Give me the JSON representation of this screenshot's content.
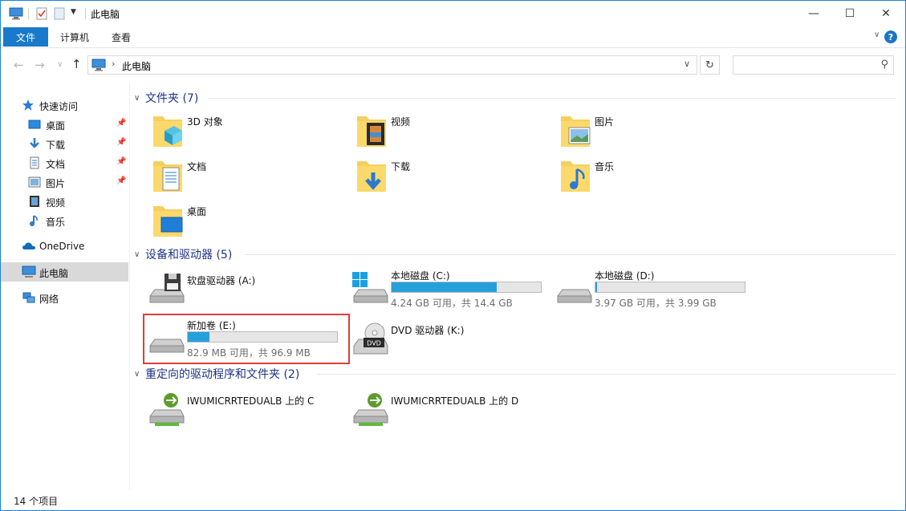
{
  "window": {
    "title": "此电脑",
    "controls": {
      "minimize": "—",
      "maximize": "☐",
      "close": "✕"
    }
  },
  "ribbon": {
    "tabs": [
      {
        "label": "文件",
        "active": true
      },
      {
        "label": "计算机",
        "active": false
      },
      {
        "label": "查看",
        "active": false
      }
    ],
    "help": "?"
  },
  "nav": {
    "back": "←",
    "forward": "→",
    "recent": "∨",
    "up": "↑",
    "address": "此电脑",
    "search_placeholder": ""
  },
  "sidebar": {
    "items": [
      {
        "label": "快速访问",
        "icon": "star-icon"
      },
      {
        "label": "桌面",
        "icon": "desktop-icon",
        "pinned": true
      },
      {
        "label": "下载",
        "icon": "download-icon",
        "pinned": true
      },
      {
        "label": "文档",
        "icon": "document-icon",
        "pinned": true
      },
      {
        "label": "图片",
        "icon": "picture-icon",
        "pinned": true
      },
      {
        "label": "视频",
        "icon": "video-icon"
      },
      {
        "label": "音乐",
        "icon": "music-icon"
      },
      {
        "label": "OneDrive",
        "icon": "cloud-icon"
      },
      {
        "label": "此电脑",
        "icon": "computer-icon",
        "active": true
      },
      {
        "label": "网络",
        "icon": "network-icon"
      }
    ]
  },
  "groups": {
    "folders": {
      "title": "文件夹 (7)",
      "items": [
        {
          "label": "3D 对象",
          "icon": "3d-objects-folder-icon"
        },
        {
          "label": "视频",
          "icon": "videos-folder-icon"
        },
        {
          "label": "图片",
          "icon": "pictures-folder-icon"
        },
        {
          "label": "文档",
          "icon": "documents-folder-icon"
        },
        {
          "label": "下载",
          "icon": "downloads-folder-icon"
        },
        {
          "label": "音乐",
          "icon": "music-folder-icon"
        },
        {
          "label": "桌面",
          "icon": "desktop-folder-icon"
        }
      ]
    },
    "devices": {
      "title": "设备和驱动器 (5)",
      "items": [
        {
          "label": "软盘驱动器 (A:)",
          "icon": "floppy-drive-icon"
        },
        {
          "label": "本地磁盘 (C:)",
          "icon": "windows-drive-icon",
          "free": "4.24 GB 可用，共 14.4 GB",
          "used_fraction": 0.706
        },
        {
          "label": "本地磁盘 (D:)",
          "icon": "hard-drive-icon",
          "free": "3.97 GB 可用，共 3.99 GB",
          "used_fraction": 0.005
        },
        {
          "label": "新加卷 (E:)",
          "icon": "hard-drive-icon",
          "free": "82.9 MB 可用，共 96.9 MB",
          "used_fraction": 0.144
        },
        {
          "label": "DVD 驱动器 (K:)",
          "icon": "dvd-drive-icon",
          "badge": "DVD"
        }
      ]
    },
    "redirected": {
      "title": "重定向的驱动程序和文件夹 (2)",
      "items": [
        {
          "label": "IWUMICRRTEDUALB 上的 C",
          "icon": "network-drive-icon"
        },
        {
          "label": "IWUMICRRTEDUALB 上的 D",
          "icon": "network-drive-icon"
        }
      ]
    }
  },
  "status": {
    "count": "14 个项目"
  },
  "colors": {
    "accent": "#1979ca",
    "bar_fill": "#26a0da",
    "group_title": "#1e3287",
    "highlight": "#e03c3c"
  }
}
